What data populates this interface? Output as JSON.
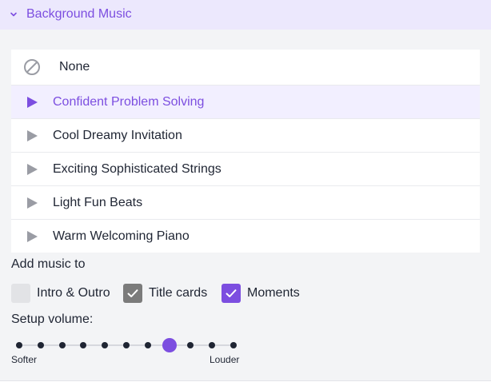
{
  "section": {
    "title": "Background Music"
  },
  "tracks": [
    {
      "label": "None",
      "icon": "none-icon"
    },
    {
      "label": "Confident Problem Solving",
      "icon": "play-icon"
    },
    {
      "label": "Cool Dreamy Invitation",
      "icon": "play-icon"
    },
    {
      "label": "Exciting Sophisticated Strings",
      "icon": "play-icon"
    },
    {
      "label": "Light Fun Beats",
      "icon": "play-icon"
    },
    {
      "label": "Warm Welcoming Piano",
      "icon": "play-icon"
    }
  ],
  "selected_track": "Confident Problem Solving",
  "add_music": {
    "label": "Add music to",
    "options": [
      {
        "label": "Intro & Outro",
        "checked": false
      },
      {
        "label": "Title cards",
        "checked": true
      },
      {
        "label": "Moments",
        "checked": true
      }
    ]
  },
  "volume": {
    "label": "Setup volume:",
    "min_label": "Softer",
    "max_label": "Louder",
    "steps": 11,
    "selected_step": 7
  },
  "colors": {
    "accent": "#7c4ee0",
    "header_bg": "#ece8fd",
    "selected_row_bg": "#f2efff",
    "play_icon": "#9a9ca4",
    "checkbox_gray": "#7b7b7b"
  }
}
